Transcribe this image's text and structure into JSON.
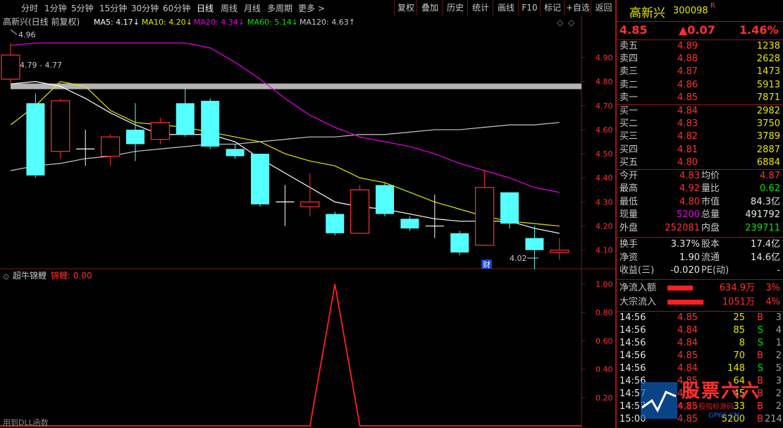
{
  "toolbar": {
    "periods": [
      "分时",
      "1分钟",
      "5分钟",
      "15分钟",
      "30分钟",
      "60分钟",
      "日线",
      "周线",
      "月线",
      "多周期",
      "更多 >"
    ],
    "active_period": "日线",
    "actions": [
      "复权",
      "叠加",
      "历史",
      "统计",
      "画线",
      "F10",
      "标记",
      "+自选",
      "返回"
    ]
  },
  "main_chart": {
    "title": "高新兴(日线 前复权)",
    "ma_labels": [
      {
        "text": "MA5: 4.17↓",
        "color": "#ffffff"
      },
      {
        "text": "MA10: 4.20↓",
        "color": "#e6e600"
      },
      {
        "text": "MA20: 4.34↓",
        "color": "#e600e6"
      },
      {
        "text": "MA60: 5.14↓",
        "color": "#00e600"
      },
      {
        "text": "MA120: 4.63↑",
        "color": "#c8c8c8"
      }
    ],
    "high_marker": "4.96",
    "range_marker": "4.79 - 4.77",
    "low_marker": "4.02",
    "finance_badge": "财",
    "y_ticks": [
      "4.90",
      "4.80",
      "4.70",
      "4.60",
      "4.50",
      "4.40",
      "4.30",
      "4.20",
      "4.10"
    ]
  },
  "chart_data": [
    {
      "type": "candlestick",
      "title": "高新兴(日线 前复权)",
      "ylim": [
        4.02,
        4.96
      ],
      "candles": [
        {
          "o": 4.81,
          "c": 4.91,
          "h": 4.96,
          "l": 4.79
        },
        {
          "o": 4.71,
          "c": 4.41,
          "h": 4.75,
          "l": 4.4
        },
        {
          "o": 4.51,
          "c": 4.72,
          "h": 4.73,
          "l": 4.48
        },
        {
          "o": 4.52,
          "c": 4.52,
          "h": 4.6,
          "l": 4.45
        },
        {
          "o": 4.49,
          "c": 4.57,
          "h": 4.58,
          "l": 4.45
        },
        {
          "o": 4.6,
          "c": 4.54,
          "h": 4.71,
          "l": 4.47
        },
        {
          "o": 4.56,
          "c": 4.63,
          "h": 4.65,
          "l": 4.54
        },
        {
          "o": 4.71,
          "c": 4.58,
          "h": 4.77,
          "l": 4.57
        },
        {
          "o": 4.72,
          "c": 4.53,
          "h": 4.73,
          "l": 4.52
        },
        {
          "o": 4.52,
          "c": 4.49,
          "h": 4.54,
          "l": 4.48
        },
        {
          "o": 4.5,
          "c": 4.29,
          "h": 4.5,
          "l": 4.28
        },
        {
          "o": 4.3,
          "c": 4.3,
          "h": 4.37,
          "l": 4.2
        },
        {
          "o": 4.28,
          "c": 4.3,
          "h": 4.42,
          "l": 4.24
        },
        {
          "o": 4.25,
          "c": 4.17,
          "h": 4.26,
          "l": 4.16
        },
        {
          "o": 4.17,
          "c": 4.35,
          "h": 4.37,
          "l": 4.17
        },
        {
          "o": 4.37,
          "c": 4.25,
          "h": 4.38,
          "l": 4.24
        },
        {
          "o": 4.23,
          "c": 4.19,
          "h": 4.24,
          "l": 4.18
        },
        {
          "o": 4.2,
          "c": 4.2,
          "h": 4.33,
          "l": 4.15
        },
        {
          "o": 4.17,
          "c": 4.09,
          "h": 4.18,
          "l": 4.08
        },
        {
          "o": 4.12,
          "c": 4.36,
          "h": 4.43,
          "l": 4.12
        },
        {
          "o": 4.34,
          "c": 4.21,
          "h": 4.34,
          "l": 4.19
        },
        {
          "o": 4.15,
          "c": 4.1,
          "h": 4.2,
          "l": 4.02
        },
        {
          "o": 4.09,
          "c": 4.1,
          "h": 4.15,
          "l": 4.06
        }
      ],
      "ma5": [
        4.79,
        4.8,
        4.78,
        4.73,
        4.67,
        4.62,
        4.58,
        4.58,
        4.58,
        4.55,
        4.48,
        4.42,
        4.36,
        4.3,
        4.28,
        4.27,
        4.25,
        4.23,
        4.22,
        4.22,
        4.22,
        4.19,
        4.17
      ],
      "ma10": [
        4.62,
        4.7,
        4.8,
        4.78,
        4.68,
        4.63,
        4.62,
        4.61,
        4.59,
        4.57,
        4.55,
        4.5,
        4.47,
        4.45,
        4.4,
        4.38,
        4.34,
        4.3,
        4.27,
        4.24,
        4.22,
        4.21,
        4.2
      ],
      "ma20": [
        4.95,
        4.96,
        4.96,
        4.96,
        4.96,
        4.96,
        4.96,
        4.96,
        4.94,
        4.88,
        4.81,
        4.73,
        4.66,
        4.61,
        4.57,
        4.55,
        4.53,
        4.5,
        4.46,
        4.43,
        4.4,
        4.36,
        4.34
      ],
      "ma120": [
        4.43,
        4.45,
        4.46,
        4.48,
        4.49,
        4.51,
        4.52,
        4.53,
        4.54,
        4.54,
        4.55,
        4.56,
        4.57,
        4.57,
        4.58,
        4.58,
        4.59,
        4.6,
        4.6,
        4.61,
        4.62,
        4.62,
        4.63
      ],
      "resistance_level": 4.78
    },
    {
      "type": "line",
      "title": "超牛锦鲤",
      "series_label": "锦鲤: 0.00",
      "ylim": [
        0,
        1.0
      ],
      "y_ticks": [
        "1.00",
        "0.80",
        "0.60",
        "0.40",
        "0.20"
      ],
      "values": [
        0,
        0,
        0,
        0,
        0,
        0,
        0,
        0,
        0,
        0,
        0,
        0,
        0,
        1,
        0,
        0,
        0,
        0,
        0,
        0,
        0,
        0,
        0
      ]
    }
  ],
  "indicator": {
    "name": "超牛锦鲤",
    "value_label": "锦鲤: 0.00",
    "footer": "用到DLL函数"
  },
  "quote": {
    "name": "高新兴",
    "code": "300098",
    "badge": "R",
    "price": "4.85",
    "change": "▲0.07",
    "pct": "1.46%",
    "asks": [
      {
        "label": "卖五",
        "price": "4.89",
        "vol": "1238"
      },
      {
        "label": "卖四",
        "price": "4.88",
        "vol": "2628"
      },
      {
        "label": "卖三",
        "price": "4.87",
        "vol": "1473"
      },
      {
        "label": "卖二",
        "price": "4.86",
        "vol": "5913"
      },
      {
        "label": "卖一",
        "price": "4.85",
        "vol": "7871"
      }
    ],
    "bids": [
      {
        "label": "买一",
        "price": "4.84",
        "vol": "2982"
      },
      {
        "label": "买二",
        "price": "4.83",
        "vol": "3750"
      },
      {
        "label": "买三",
        "price": "4.82",
        "vol": "3789"
      },
      {
        "label": "买四",
        "price": "4.81",
        "vol": "2887"
      },
      {
        "label": "买五",
        "price": "4.80",
        "vol": "6884"
      }
    ],
    "stats": [
      {
        "l1": "今开",
        "v1": "4.83",
        "c1": "red",
        "l2": "均价",
        "v2": "4.87",
        "c2": "red"
      },
      {
        "l1": "最高",
        "v1": "4.92",
        "c1": "red",
        "l2": "量比",
        "v2": "0.62",
        "c2": "green"
      },
      {
        "l1": "最低",
        "v1": "4.80",
        "c1": "red",
        "l2": "市值",
        "v2": "84.3亿",
        "c2": "white"
      },
      {
        "l1": "现量",
        "v1": "5200",
        "c1": "mag",
        "l2": "总量",
        "v2": "491792",
        "c2": "white"
      },
      {
        "l1": "外盘",
        "v1": "252081",
        "c1": "red",
        "l2": "内盘",
        "v2": "239711",
        "c2": "green"
      }
    ],
    "fund": [
      {
        "l1": "换手",
        "v1": "3.37%",
        "l2": "股本",
        "v2": "17.4亿"
      },
      {
        "l1": "净资",
        "v1": "1.90",
        "l2": "流通",
        "v2": "14.6亿"
      },
      {
        "l1": "收益(三)",
        "v1": "-0.020",
        "l2": "PE(动)",
        "v2": "-"
      }
    ],
    "flows": [
      {
        "label": "净流入额",
        "value": "634.9万",
        "pct": "3%",
        "bar": 0.6
      },
      {
        "label": "大宗流入",
        "value": "1051万",
        "pct": "4%",
        "bar": 0.85
      }
    ],
    "ticks": [
      {
        "t": "14:56",
        "p": "4.85",
        "v": "25",
        "s": "B",
        "n": "3"
      },
      {
        "t": "14:56",
        "p": "4.84",
        "v": "85",
        "s": "S",
        "n": "4"
      },
      {
        "t": "14:56",
        "p": "4.84",
        "v": "8",
        "s": "S",
        "n": "1"
      },
      {
        "t": "14:56",
        "p": "4.85",
        "v": "70",
        "s": "B",
        "n": "2"
      },
      {
        "t": "14:56",
        "p": "4.84",
        "v": "148",
        "s": "S",
        "n": "5"
      },
      {
        "t": "14:56",
        "p": "4.85",
        "v": "64",
        "s": "B",
        "n": "3"
      },
      {
        "t": "14:57",
        "p": "4.85",
        "v": "45",
        "s": "B",
        "n": "2"
      },
      {
        "t": "14:57",
        "p": "4.85",
        "v": "33",
        "s": "B",
        "n": "2"
      },
      {
        "t": "15:00",
        "p": "4.85",
        "v": "5200",
        "s": "B",
        "n": "214"
      }
    ]
  },
  "watermark": {
    "text": "股票六六",
    "sub": "专注炒股指标源码",
    "url": "GP66.CN"
  },
  "colors": {
    "up": "#ff3232",
    "down_fill": "#54ffff",
    "ma5": "#ffffff",
    "ma10": "#e6e600",
    "ma20": "#e600e6",
    "ma120": "#c8c8c8",
    "grid": "#7a1a1a"
  }
}
